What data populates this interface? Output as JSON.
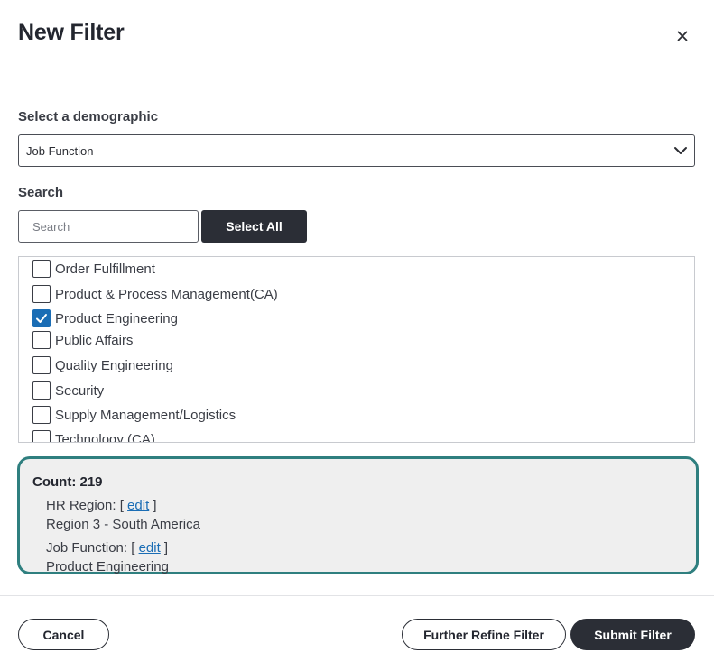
{
  "dialog": {
    "title": "New Filter"
  },
  "demographic": {
    "label": "Select a demographic",
    "selected": "Job Function"
  },
  "search": {
    "label": "Search",
    "placeholder": "Search",
    "select_all_label": "Select All"
  },
  "options": [
    {
      "label": "Order Fulfillment",
      "checked": false
    },
    {
      "label": "Product & Process Management(CA)",
      "checked": false
    },
    {
      "label": "Product Engineering",
      "checked": true
    },
    {
      "label": "Public Affairs",
      "checked": false
    },
    {
      "label": "Quality Engineering",
      "checked": false
    },
    {
      "label": "Security",
      "checked": false
    },
    {
      "label": "Supply Management/Logistics",
      "checked": false
    },
    {
      "label": "Technology (CA)",
      "checked": false
    }
  ],
  "summary": {
    "count_text": "Count: 219",
    "criteria": [
      {
        "name": "HR Region: [ ",
        "edit": "edit",
        "close": " ]",
        "value": "Region 3 - South America"
      },
      {
        "name": "Job Function: [ ",
        "edit": "edit",
        "close": " ]",
        "value": "Product Engineering"
      }
    ]
  },
  "footer": {
    "cancel_label": "Cancel",
    "refine_label": "Further Refine Filter",
    "submit_label": "Submit Filter"
  },
  "colors": {
    "accent_teal": "#2f7f7f",
    "link_blue": "#1a6db5",
    "dark_button": "#2b2e36"
  },
  "icons": {
    "close": "close-icon",
    "dropdown": "chevron-down-icon",
    "check": "checkmark-icon"
  }
}
